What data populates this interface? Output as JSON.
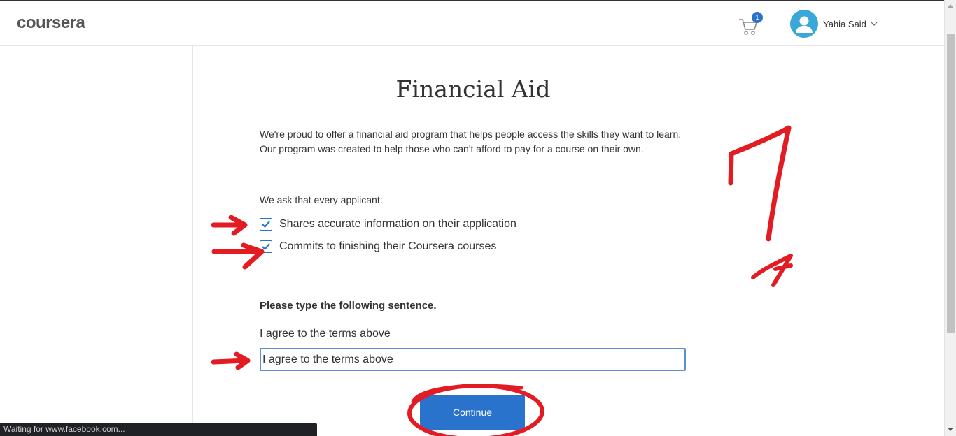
{
  "header": {
    "logo": "coursera",
    "cart_count": "1",
    "user_name": "Yahia Said"
  },
  "page": {
    "title": "Financial Aid",
    "intro": "We're proud to offer a financial aid program that helps people access the skills they want to learn. Our program was created to help those who can't afford to pay for a course on their own.",
    "ask_label": "We ask that every applicant:",
    "checks": [
      {
        "label": "Shares accurate information on their application",
        "checked": true
      },
      {
        "label": "Commits to finishing their Coursera courses",
        "checked": true
      }
    ],
    "prompt": "Please type the following sentence.",
    "sentence": "I agree to the terms above",
    "input_value": "I agree to the terms above",
    "continue_label": "Continue"
  },
  "status_bar": "Waiting for www.facebook.com...",
  "colors": {
    "accent": "#2a73cc",
    "annotation": "#e31b23"
  }
}
